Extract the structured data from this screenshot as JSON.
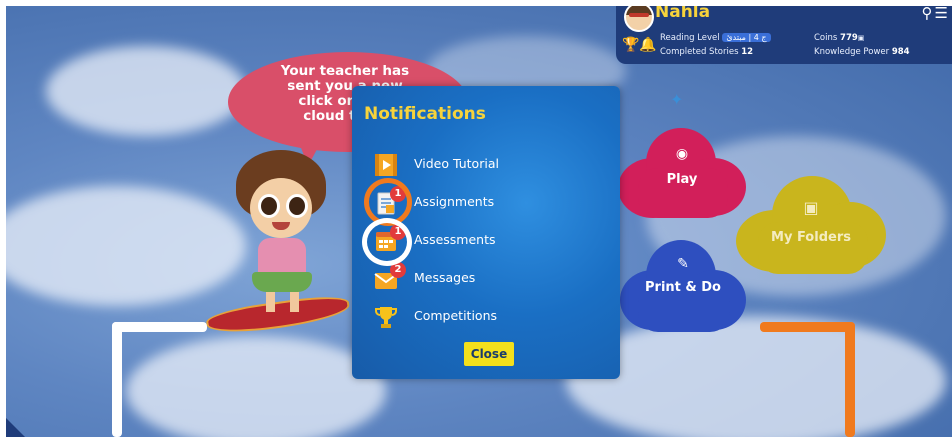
{
  "user": {
    "name": "Nahla",
    "reading_level_label": "Reading Level",
    "reading_level_value": "ج 4 | مبتدئ",
    "completed_stories_label": "Completed Stories",
    "completed_stories_value": "12",
    "coins_label": "Coins",
    "coins_value": "779",
    "knowledge_power_label": "Knowledge Power",
    "knowledge_power_value": "984"
  },
  "speech_bubble": {
    "line1": "Your teacher has",
    "line2": "sent you a new",
    "line3": "click on 'Ass",
    "line4": "cloud to co"
  },
  "home_menu": {
    "play": "Play",
    "my_folders": "My Folders",
    "print_and_do": "Print & Do"
  },
  "notifications": {
    "title": "Notifications",
    "items": [
      {
        "label": "Video Tutorial",
        "icon": "video-icon",
        "badge": null
      },
      {
        "label": "Assignments",
        "icon": "assignment-icon",
        "badge": "1"
      },
      {
        "label": "Assessments",
        "icon": "assessment-icon",
        "badge": "1"
      },
      {
        "label": "Messages",
        "icon": "envelope-icon",
        "badge": "2"
      },
      {
        "label": "Competitions",
        "icon": "trophy-icon",
        "badge": null
      }
    ],
    "close_label": "Close"
  },
  "colors": {
    "accent_yellow": "#f7d33b",
    "badge_red": "#e23b3b",
    "highlight_orange": "#f07a1e",
    "highlight_white": "#ffffff",
    "play_cloud": "#d21f5a",
    "folders_cloud": "#c9b51d",
    "print_cloud": "#2e4fbf"
  }
}
